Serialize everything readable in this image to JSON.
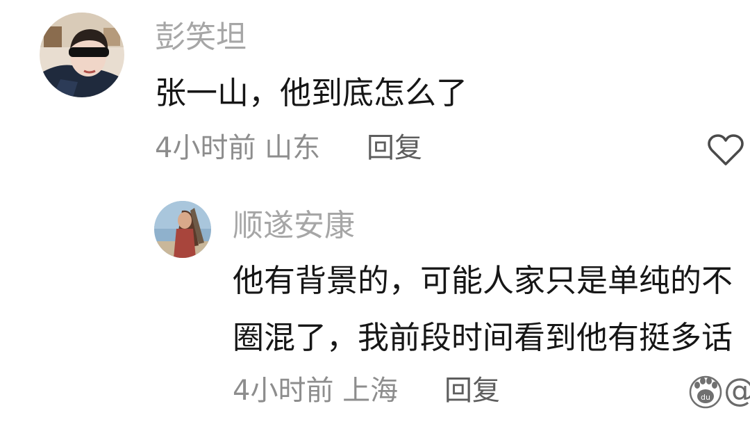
{
  "comments": [
    {
      "author": "彭笑坦",
      "text": "张一山，他到底怎么了",
      "meta": "4小时前 山东",
      "reply_label": "回复",
      "avatar_icon": "user-avatar-sunglasses"
    },
    {
      "author": "顺遂安康",
      "text_line1": "他有背景的，可能人家只是单纯的不",
      "text_line2": "圈混了，我前段时间看到他有挺多话",
      "meta": "4小时前 上海",
      "reply_label": "回复",
      "avatar_icon": "user-avatar-woman-beach"
    }
  ],
  "like_icon": "heart-outline-icon",
  "watermark": {
    "icon": "du-paw-icon",
    "symbol": "@"
  },
  "colors": {
    "name": "#a6a6a6",
    "text": "#161616",
    "meta": "#8d8d8d",
    "reply": "#5d5d5d",
    "icon": "#4a4a4a"
  }
}
